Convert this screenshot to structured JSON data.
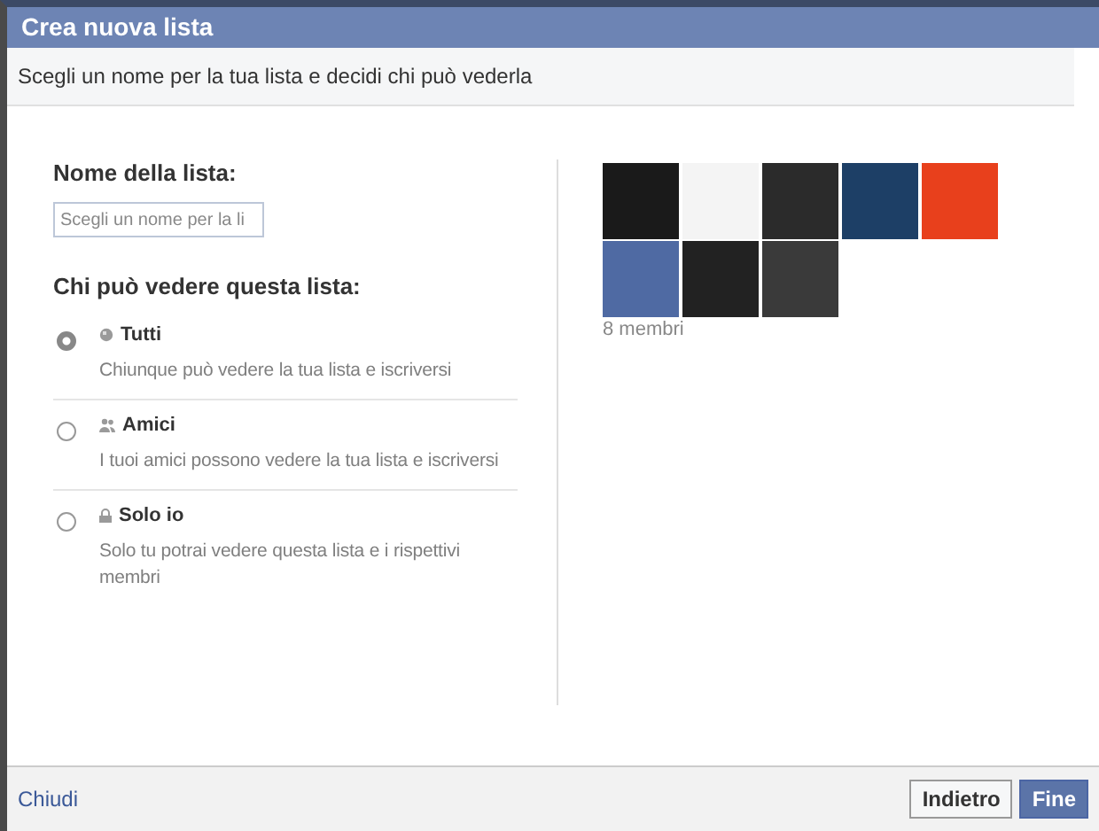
{
  "dialog": {
    "title": "Crea nuova lista",
    "subtitle": "Scegli un nome per la tua lista e decidi chi può vederla"
  },
  "name_field": {
    "label": "Nome della lista:",
    "placeholder": "Scegli un nome per la li"
  },
  "visibility": {
    "label": "Chi può vedere questa lista:",
    "options": [
      {
        "kind": "everyone",
        "title": "Tutti",
        "description": "Chiunque può vedere la tua lista e iscriversi",
        "selected": true
      },
      {
        "kind": "friends",
        "title": "Amici",
        "description": "I tuoi amici possono vedere la tua lista e iscriversi",
        "selected": false
      },
      {
        "kind": "private",
        "title": "Solo io",
        "description": "Solo tu potrai vedere questa lista e i rispettivi membri",
        "selected": false
      }
    ]
  },
  "members": {
    "avatars": [
      {
        "color": "#1a1a1a"
      },
      {
        "color": "#f4f4f4"
      },
      {
        "color": "#2b2b2b"
      },
      {
        "color": "#1d3f66"
      },
      {
        "color": "#e8401c"
      },
      {
        "color": "#4f6aa3"
      },
      {
        "color": "#222222"
      },
      {
        "color": "#3a3a3a"
      }
    ],
    "count": "8 membri"
  },
  "footer": {
    "close_link": "Chiudi",
    "buttons": [
      {
        "kind": "secondary",
        "label": "Indietro"
      },
      {
        "kind": "primary",
        "label": "Fine"
      }
    ]
  }
}
